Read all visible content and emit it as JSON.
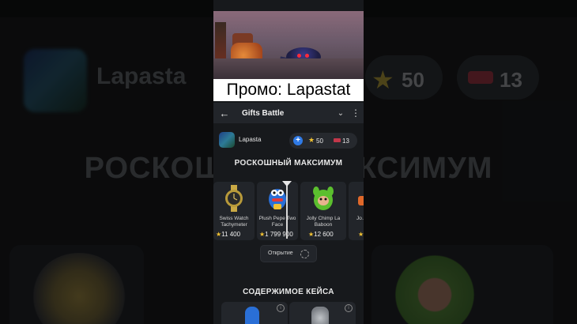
{
  "promo": {
    "text": "Промо: Lapastat"
  },
  "appbar": {
    "title": "Gifts Battle",
    "back_icon": "←",
    "chevron_icon": "⌄",
    "more_icon": "⋮"
  },
  "user": {
    "name": "Lapasta",
    "stars": "50",
    "tickets": "13",
    "plus_icon": "+",
    "star_icon": "★"
  },
  "background": {
    "name": "Lapasta",
    "stars": "50",
    "tickets": "13",
    "title": "РОСКОШНЫЙ МАКСИМУМ"
  },
  "sections": {
    "roulette_title": "РОСКОШНЫЙ МАКСИМУМ",
    "contents_title": "СОДЕРЖИМОЕ КЕЙСА"
  },
  "items": [
    {
      "name": "Swiss Watch Tachymeter",
      "price": "11 400"
    },
    {
      "name": "Plush Pepe Two Face",
      "price": "1 799 900"
    },
    {
      "name": "Jolly Chimp La Baboon",
      "price": "12 600"
    },
    {
      "name": "Jo… Sn…",
      "price": ""
    }
  ],
  "open_button": {
    "label": "Открытие"
  },
  "colors": {
    "accent": "#2f7ae6",
    "star": "#f2c232",
    "ticket": "#c2374a",
    "background": "#17191c"
  }
}
